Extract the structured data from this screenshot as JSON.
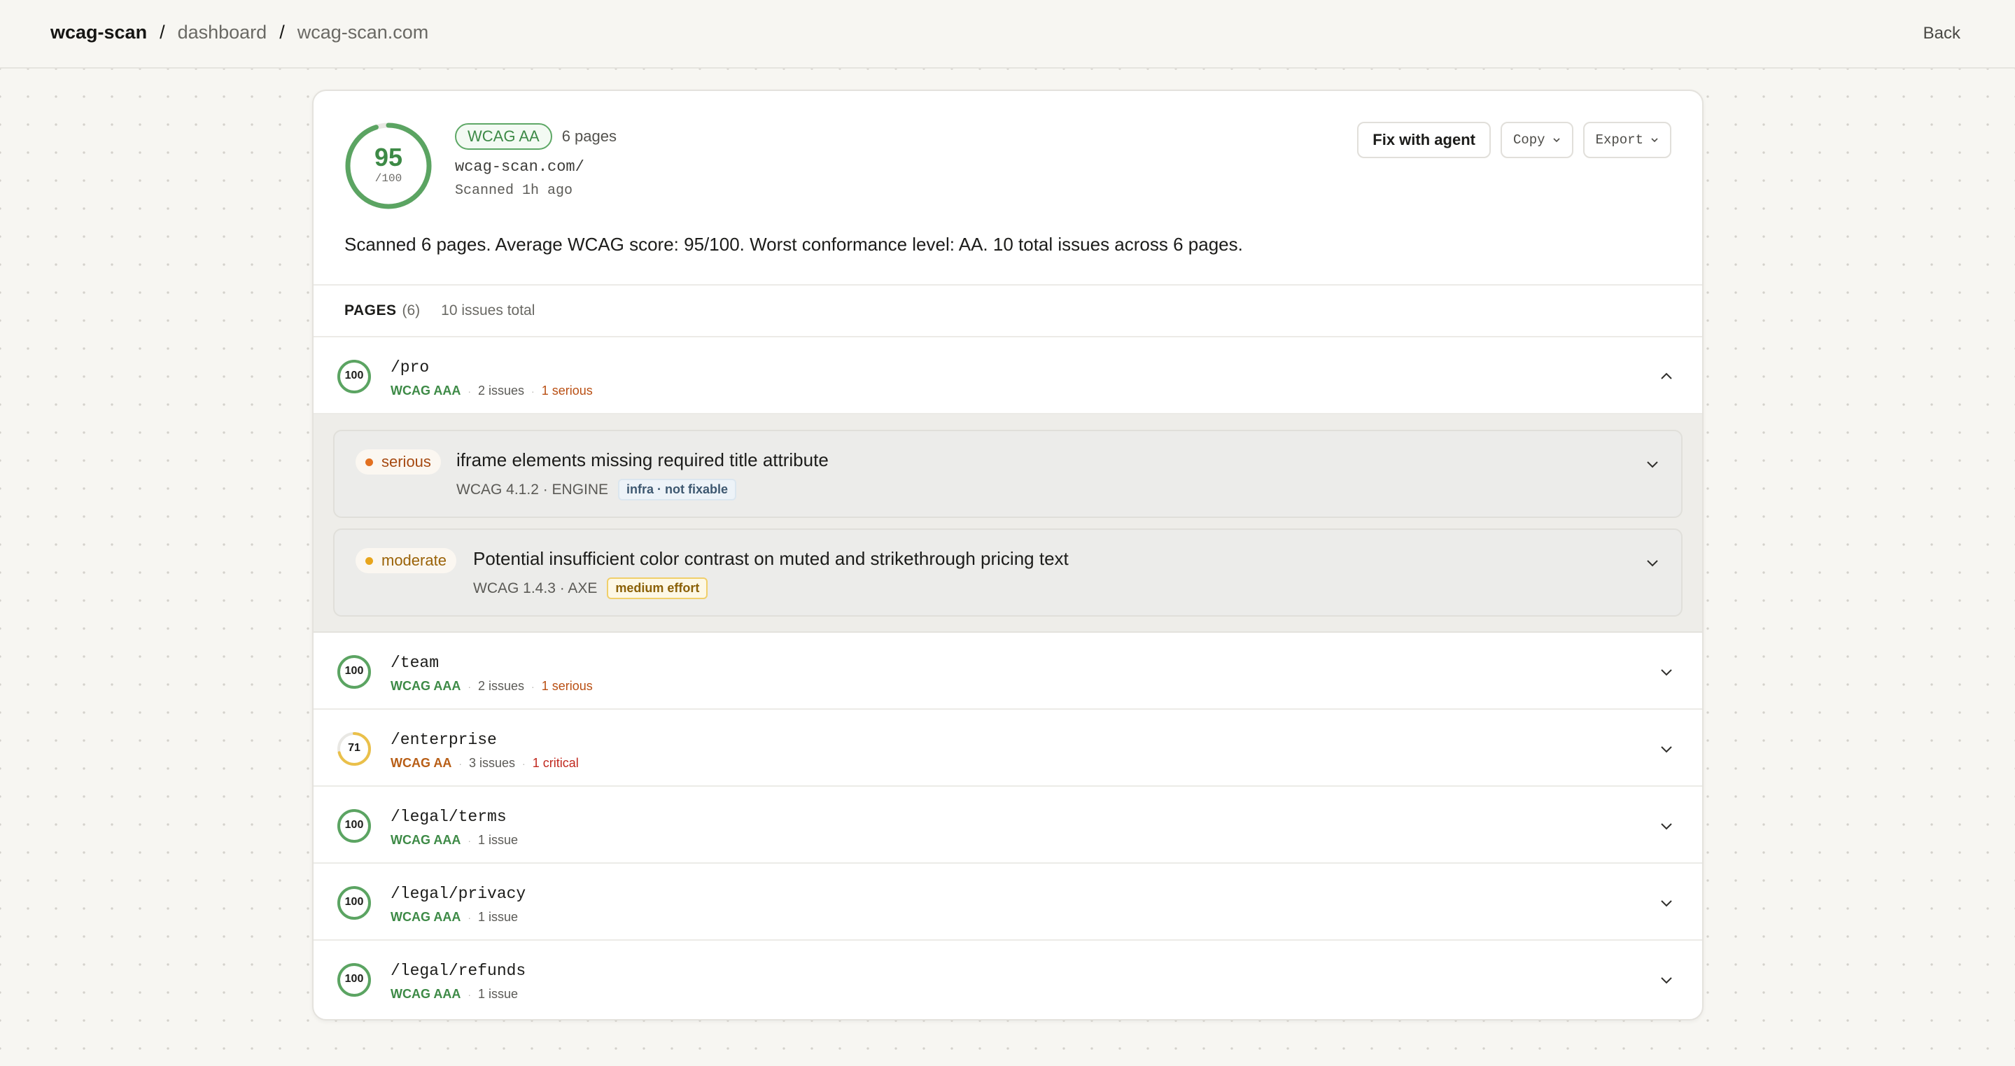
{
  "breadcrumb": {
    "root": "wcag-scan",
    "items": [
      "dashboard",
      "wcag-scan.com"
    ],
    "sep": "/"
  },
  "header": {
    "back_label": "Back"
  },
  "summary": {
    "score": "95",
    "score_max": "/100",
    "score_fraction": 0.95,
    "level_badge": "WCAG AA",
    "pages_count": "6 pages",
    "url": "wcag-scan.com/",
    "scanned_ago": "Scanned 1h ago",
    "description": "Scanned 6 pages. Average WCAG score: 95/100. Worst conformance level: AA. 10 total issues across 6 pages."
  },
  "actions": {
    "fix_label": "Fix with agent",
    "copy_label": "Copy",
    "export_label": "Export"
  },
  "pages_header": {
    "label": "PAGES",
    "count": "(6)",
    "total": "10 issues total"
  },
  "colors": {
    "green": "#3d8a46",
    "ring_green": "#5ba462",
    "ring_yellow": "#eac04a",
    "serious": "#b94f13",
    "critical": "#c0281e"
  },
  "pages": [
    {
      "score": "100",
      "score_fraction": 1.0,
      "path": "/pro",
      "level": "WCAG AAA",
      "issues": "2 issues",
      "severity": "1 serious",
      "expanded": true,
      "details": [
        {
          "severity": "serious",
          "title": "iframe elements missing required title attribute",
          "meta": "WCAG 4.1.2 · ENGINE",
          "tag": "infra · not fixable"
        },
        {
          "severity": "moderate",
          "title": "Potential insufficient color contrast on muted and strikethrough pricing text",
          "meta": "WCAG 1.4.3 · AXE",
          "tag": "medium effort"
        }
      ]
    },
    {
      "score": "100",
      "score_fraction": 1.0,
      "path": "/team",
      "level": "WCAG AAA",
      "issues": "2 issues",
      "severity": "1 serious"
    },
    {
      "score": "71",
      "score_fraction": 0.71,
      "path": "/enterprise",
      "level": "WCAG AA",
      "issues": "3 issues",
      "severity": "1 critical"
    },
    {
      "score": "100",
      "score_fraction": 1.0,
      "path": "/legal/terms",
      "level": "WCAG AAA",
      "issues": "1 issue"
    },
    {
      "score": "100",
      "score_fraction": 1.0,
      "path": "/legal/privacy",
      "level": "WCAG AAA",
      "issues": "1 issue"
    },
    {
      "score": "100",
      "score_fraction": 1.0,
      "path": "/legal/refunds",
      "level": "WCAG AAA",
      "issues": "1 issue"
    }
  ]
}
